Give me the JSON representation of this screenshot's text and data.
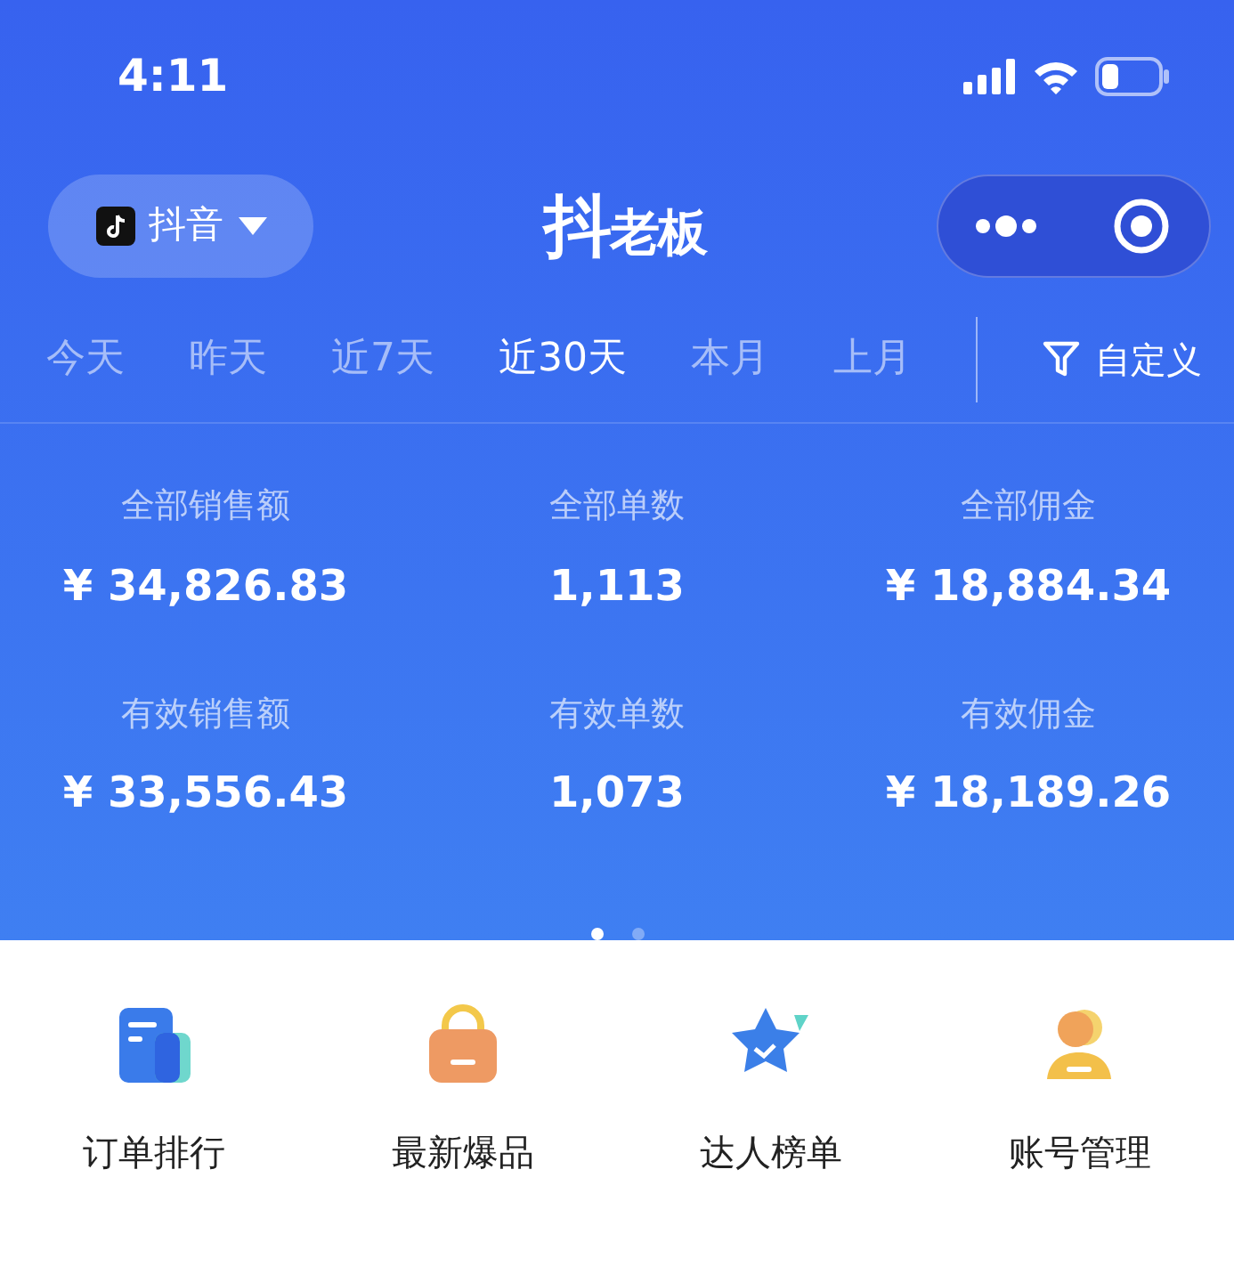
{
  "status_bar": {
    "time": "4:11"
  },
  "platform_selector": {
    "label": "抖音"
  },
  "app_title": {
    "lead": "抖",
    "rest": "老板"
  },
  "date_tabs": [
    {
      "label": "今天",
      "selected": false
    },
    {
      "label": "昨天",
      "selected": false
    },
    {
      "label": "近7天",
      "selected": false
    },
    {
      "label": "近30天",
      "selected": true
    },
    {
      "label": "本月",
      "selected": false
    },
    {
      "label": "上月",
      "selected": false
    }
  ],
  "custom_filter": {
    "label": "自定义"
  },
  "stats": [
    {
      "label": "全部销售额",
      "value": "¥ 34,826.83"
    },
    {
      "label": "全部单数",
      "value": "1,113"
    },
    {
      "label": "全部佣金",
      "value": "¥ 18,884.34"
    },
    {
      "label": "有效销售额",
      "value": "¥ 33,556.43"
    },
    {
      "label": "有效单数",
      "value": "1,073"
    },
    {
      "label": "有效佣金",
      "value": "¥ 18,189.26"
    }
  ],
  "page_dots": [
    {
      "selected": true
    },
    {
      "selected": false
    }
  ],
  "shortcuts": [
    {
      "label": "订单排行",
      "kind": "orders"
    },
    {
      "label": "最新爆品",
      "kind": "hot"
    },
    {
      "label": "达人榜单",
      "kind": "ranking"
    },
    {
      "label": "账号管理",
      "kind": "account"
    }
  ]
}
